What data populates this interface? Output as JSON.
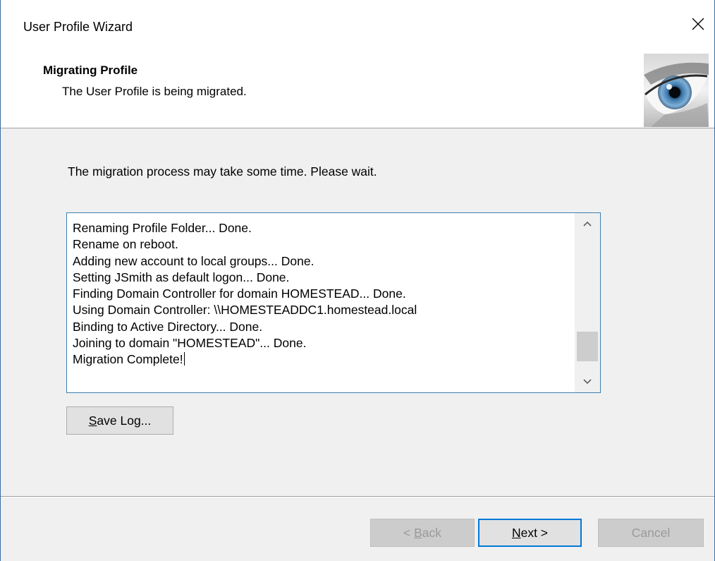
{
  "window": {
    "title": "User Profile Wizard"
  },
  "header": {
    "title": "Migrating Profile",
    "subtitle": "The User Profile is being migrated."
  },
  "main": {
    "instruction": "The migration process may take some time. Please wait.",
    "log_lines": [
      "Renaming Profile Folder... Done.",
      "Rename on reboot.",
      "Adding new account to local groups... Done.",
      "Setting JSmith as default logon... Done.",
      "Finding Domain Controller for domain HOMESTEAD... Done.",
      "Using Domain Controller: \\\\HOMESTEADDC1.homestead.local",
      "Binding to Active Directory... Done.",
      "Joining to domain \"HOMESTEAD\"... Done.",
      "Migration Complete!"
    ],
    "save_log_mnemonic": "S",
    "save_log_rest": "ave Log..."
  },
  "footer": {
    "back_prefix": "< ",
    "back_mnemonic": "B",
    "back_rest": "ack",
    "next_mnemonic": "N",
    "next_rest": "ext >",
    "cancel_label": "Cancel"
  },
  "colors": {
    "accent": "#0078d7",
    "window_border": "#3a6ea5",
    "dialog_bg": "#f0f0f0"
  },
  "icons": {
    "close": "close-icon",
    "header_image": "eye-image",
    "scroll_up": "chevron-up-icon",
    "scroll_down": "chevron-down-icon"
  }
}
